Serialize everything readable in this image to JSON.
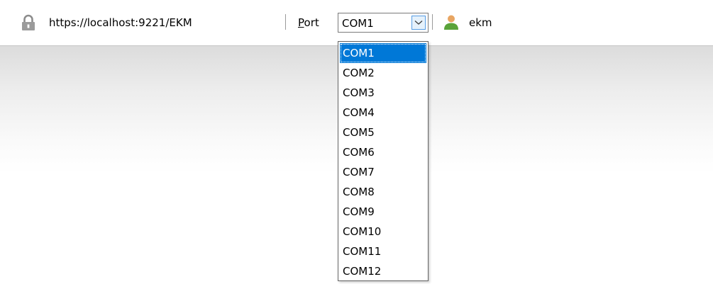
{
  "toolbar": {
    "url": "https://localhost:9221/EKM",
    "port_mnemonic": "P",
    "port_rest": "ort",
    "selected_port": "COM1",
    "user": "ekm"
  },
  "dropdown": {
    "options": [
      "COM1",
      "COM2",
      "COM3",
      "COM4",
      "COM5",
      "COM6",
      "COM7",
      "COM8",
      "COM9",
      "COM10",
      "COM11",
      "COM12"
    ],
    "highlighted": "COM1"
  },
  "icons": {
    "lock": "lock-icon",
    "user": "user-icon",
    "dropdown": "chevron-down-icon"
  },
  "colors": {
    "selection": "#0078d7",
    "combo_button": "#e5f1fb",
    "user_icon_head": "#e8a562",
    "user_icon_body": "#5aa33a"
  }
}
